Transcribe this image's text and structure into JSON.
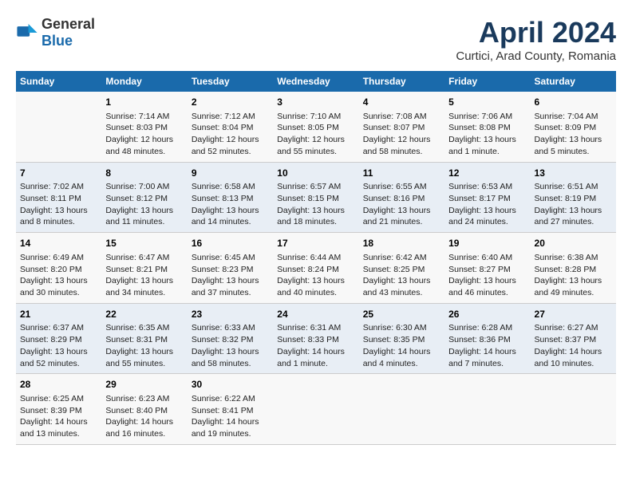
{
  "header": {
    "logo_general": "General",
    "logo_blue": "Blue",
    "month_year": "April 2024",
    "location": "Curtici, Arad County, Romania"
  },
  "days_of_week": [
    "Sunday",
    "Monday",
    "Tuesday",
    "Wednesday",
    "Thursday",
    "Friday",
    "Saturday"
  ],
  "weeks": [
    [
      {
        "day": "",
        "info": ""
      },
      {
        "day": "1",
        "info": "Sunrise: 7:14 AM\nSunset: 8:03 PM\nDaylight: 12 hours and 48 minutes."
      },
      {
        "day": "2",
        "info": "Sunrise: 7:12 AM\nSunset: 8:04 PM\nDaylight: 12 hours and 52 minutes."
      },
      {
        "day": "3",
        "info": "Sunrise: 7:10 AM\nSunset: 8:05 PM\nDaylight: 12 hours and 55 minutes."
      },
      {
        "day": "4",
        "info": "Sunrise: 7:08 AM\nSunset: 8:07 PM\nDaylight: 12 hours and 58 minutes."
      },
      {
        "day": "5",
        "info": "Sunrise: 7:06 AM\nSunset: 8:08 PM\nDaylight: 13 hours and 1 minute."
      },
      {
        "day": "6",
        "info": "Sunrise: 7:04 AM\nSunset: 8:09 PM\nDaylight: 13 hours and 5 minutes."
      }
    ],
    [
      {
        "day": "7",
        "info": "Sunrise: 7:02 AM\nSunset: 8:11 PM\nDaylight: 13 hours and 8 minutes."
      },
      {
        "day": "8",
        "info": "Sunrise: 7:00 AM\nSunset: 8:12 PM\nDaylight: 13 hours and 11 minutes."
      },
      {
        "day": "9",
        "info": "Sunrise: 6:58 AM\nSunset: 8:13 PM\nDaylight: 13 hours and 14 minutes."
      },
      {
        "day": "10",
        "info": "Sunrise: 6:57 AM\nSunset: 8:15 PM\nDaylight: 13 hours and 18 minutes."
      },
      {
        "day": "11",
        "info": "Sunrise: 6:55 AM\nSunset: 8:16 PM\nDaylight: 13 hours and 21 minutes."
      },
      {
        "day": "12",
        "info": "Sunrise: 6:53 AM\nSunset: 8:17 PM\nDaylight: 13 hours and 24 minutes."
      },
      {
        "day": "13",
        "info": "Sunrise: 6:51 AM\nSunset: 8:19 PM\nDaylight: 13 hours and 27 minutes."
      }
    ],
    [
      {
        "day": "14",
        "info": "Sunrise: 6:49 AM\nSunset: 8:20 PM\nDaylight: 13 hours and 30 minutes."
      },
      {
        "day": "15",
        "info": "Sunrise: 6:47 AM\nSunset: 8:21 PM\nDaylight: 13 hours and 34 minutes."
      },
      {
        "day": "16",
        "info": "Sunrise: 6:45 AM\nSunset: 8:23 PM\nDaylight: 13 hours and 37 minutes."
      },
      {
        "day": "17",
        "info": "Sunrise: 6:44 AM\nSunset: 8:24 PM\nDaylight: 13 hours and 40 minutes."
      },
      {
        "day": "18",
        "info": "Sunrise: 6:42 AM\nSunset: 8:25 PM\nDaylight: 13 hours and 43 minutes."
      },
      {
        "day": "19",
        "info": "Sunrise: 6:40 AM\nSunset: 8:27 PM\nDaylight: 13 hours and 46 minutes."
      },
      {
        "day": "20",
        "info": "Sunrise: 6:38 AM\nSunset: 8:28 PM\nDaylight: 13 hours and 49 minutes."
      }
    ],
    [
      {
        "day": "21",
        "info": "Sunrise: 6:37 AM\nSunset: 8:29 PM\nDaylight: 13 hours and 52 minutes."
      },
      {
        "day": "22",
        "info": "Sunrise: 6:35 AM\nSunset: 8:31 PM\nDaylight: 13 hours and 55 minutes."
      },
      {
        "day": "23",
        "info": "Sunrise: 6:33 AM\nSunset: 8:32 PM\nDaylight: 13 hours and 58 minutes."
      },
      {
        "day": "24",
        "info": "Sunrise: 6:31 AM\nSunset: 8:33 PM\nDaylight: 14 hours and 1 minute."
      },
      {
        "day": "25",
        "info": "Sunrise: 6:30 AM\nSunset: 8:35 PM\nDaylight: 14 hours and 4 minutes."
      },
      {
        "day": "26",
        "info": "Sunrise: 6:28 AM\nSunset: 8:36 PM\nDaylight: 14 hours and 7 minutes."
      },
      {
        "day": "27",
        "info": "Sunrise: 6:27 AM\nSunset: 8:37 PM\nDaylight: 14 hours and 10 minutes."
      }
    ],
    [
      {
        "day": "28",
        "info": "Sunrise: 6:25 AM\nSunset: 8:39 PM\nDaylight: 14 hours and 13 minutes."
      },
      {
        "day": "29",
        "info": "Sunrise: 6:23 AM\nSunset: 8:40 PM\nDaylight: 14 hours and 16 minutes."
      },
      {
        "day": "30",
        "info": "Sunrise: 6:22 AM\nSunset: 8:41 PM\nDaylight: 14 hours and 19 minutes."
      },
      {
        "day": "",
        "info": ""
      },
      {
        "day": "",
        "info": ""
      },
      {
        "day": "",
        "info": ""
      },
      {
        "day": "",
        "info": ""
      }
    ]
  ]
}
